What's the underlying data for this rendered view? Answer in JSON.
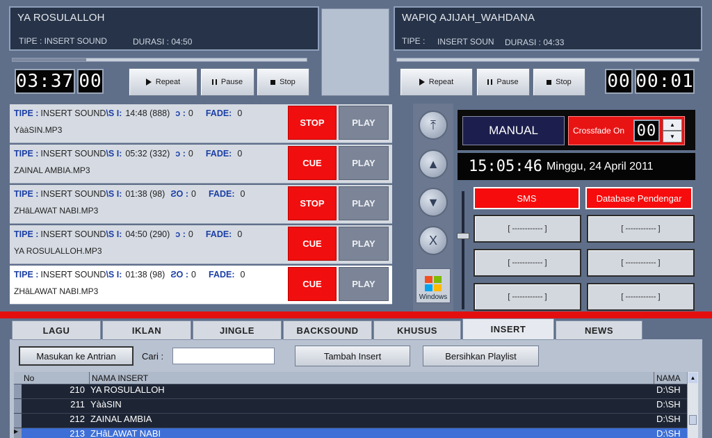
{
  "deck_a": {
    "title": "YA ROSULALLOH",
    "tipe": "TIPE :  INSERT SOUND",
    "durasi": "DURASI : 04:50",
    "time_main": "03:37",
    "time_sub": "00",
    "progress": 0.25
  },
  "deck_b": {
    "title": "WAPIQ AJIJAH_WAHDANA",
    "tipe": "TIPE :",
    "tipe_value": "INSERT SOUN",
    "durasi": "DURASI : 04:33",
    "time_main": "00",
    "time_sub": "00:01",
    "progress": 0.0
  },
  "controls": {
    "repeat": "Repeat",
    "pause": "Pause",
    "stop": "Stop"
  },
  "playlist": [
    {
      "tipe_label": "TIPE :",
      "tipe": "INSERT SOUND",
      "durasi_label": "\\S I:",
      "durasi": "14:48 (888)",
      "o_label": "ɔ :",
      "o": "0",
      "fade_label": "FADE:",
      "fade": "0",
      "file": "YààSIN.MP3",
      "action": "STOP",
      "play": "PLAY"
    },
    {
      "tipe_label": "TIPE :",
      "tipe": "INSERT SOUND",
      "durasi_label": "\\S I:",
      "durasi": "05:32 (332)",
      "o_label": "ɔ :",
      "o": "0",
      "fade_label": "FADE:",
      "fade": "0",
      "file": "ZAINAL AMBIA.MP3",
      "action": "CUE",
      "play": "PLAY"
    },
    {
      "tipe_label": "TIPE :",
      "tipe": "INSERT SOUND",
      "durasi_label": "\\S I:",
      "durasi": "01:38 (98)",
      "o_label": "ƧO :",
      "o": "0",
      "fade_label": "FADE:",
      "fade": "0",
      "file": "ZHâLAWAT NABI.MP3",
      "action": "STOP",
      "play": "PLAY"
    },
    {
      "tipe_label": "TIPE :",
      "tipe": "INSERT SOUND",
      "durasi_label": "\\S I:",
      "durasi": "04:50 (290)",
      "o_label": "ɔ :",
      "o": "0",
      "fade_label": "FADE:",
      "fade": "0",
      "file": "YA ROSULALLOH.MP3",
      "action": "CUE",
      "play": "PLAY"
    },
    {
      "tipe_label": "TIPE :",
      "tipe": "INSERT SOUND",
      "durasi_label": "\\S I:",
      "durasi": "01:38 (98)",
      "o_label": "ƧO :",
      "o": "0",
      "fade_label": "FADE:",
      "fade": "0",
      "file": "ZHâLAWAT NABI.MP3",
      "action": "CUE",
      "play": "PLAY"
    }
  ],
  "mode": {
    "label": "MANUAL",
    "crossfade_label": "Crossfade On",
    "crossfade_value": "00"
  },
  "clock": {
    "time": "15:05:46",
    "date": "Minggu, 24 April 2011"
  },
  "side_buttons": {
    "sms": "SMS",
    "database": "Database Pendengar",
    "slot": "[ ------------ ]"
  },
  "windows_label": "Windows",
  "tabs": [
    "LAGU",
    "IKLAN",
    "JINGLE",
    "BACKSOUND",
    "KHUSUS",
    "INSERT",
    "NEWS"
  ],
  "actions": {
    "queue": "Masukan ke Antrian",
    "search_label": "Cari :",
    "search_value": "",
    "add": "Tambah Insert",
    "clear": "Bersihkan Playlist"
  },
  "grid": {
    "headers": [
      "No",
      "NAMA INSERT",
      "NAMA"
    ],
    "rows": [
      {
        "no": "210",
        "name": "YA ROSULALLOH",
        "path": "D:\\SH"
      },
      {
        "no": "211",
        "name": "YààSIN",
        "path": "D:\\SH"
      },
      {
        "no": "212",
        "name": "ZAINAL AMBIA",
        "path": "D:\\SH"
      },
      {
        "no": "213",
        "name": "ZHâLAWAT NABI",
        "path": "D:\\SH"
      }
    ]
  },
  "colors": {
    "accent_red": "#f10e0e",
    "panel_dark": "#263348",
    "selected_row": "#3d6fd6"
  }
}
